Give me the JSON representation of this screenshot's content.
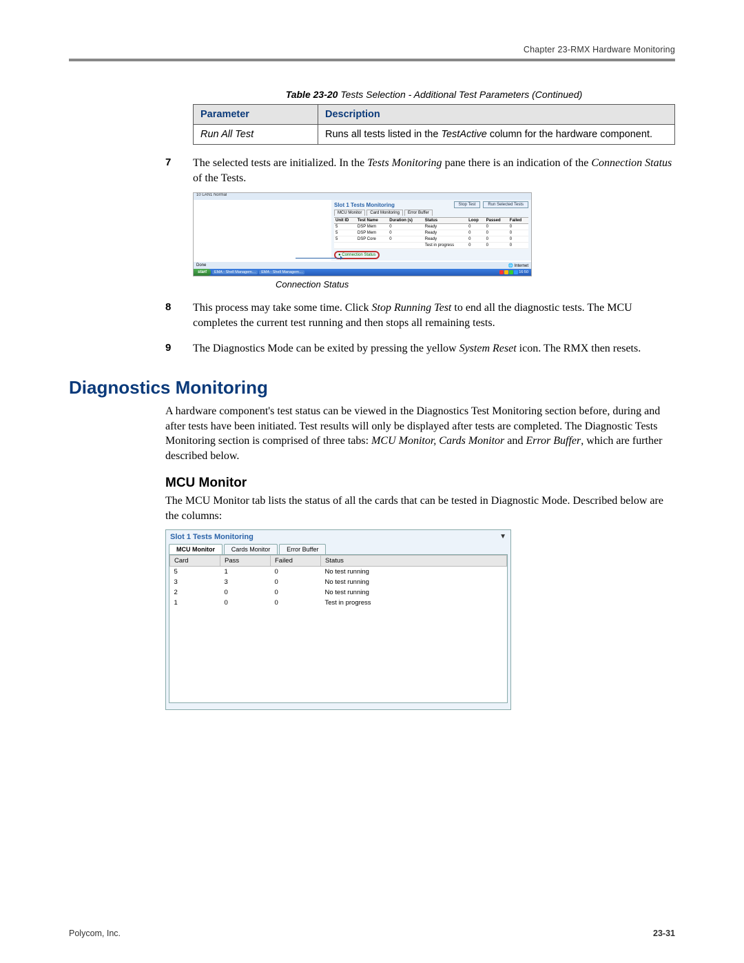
{
  "header": {
    "chapter": "Chapter 23-RMX Hardware Monitoring"
  },
  "table_caption": {
    "label": "Table 23-20",
    "rest": " Tests Selection - Additional Test Parameters (Continued)"
  },
  "param_table": {
    "headers": {
      "param": "Parameter",
      "desc": "Description"
    },
    "row": {
      "param": "Run All Test",
      "desc_1": "Runs all tests listed in the ",
      "desc_em": "TestActive",
      "desc_2": " column for the hardware component."
    }
  },
  "steps": {
    "s7": {
      "num": "7",
      "t1": "The selected tests are initialized. In the ",
      "em1": "Tests Monitoring",
      "t2": " pane there is an indication of the ",
      "em2": "Connection Status",
      "t3": " of the Tests."
    },
    "s8": {
      "num": "8",
      "t1": "This process may take some time. Click ",
      "em1": "Stop Running Test",
      "t2": " to end all the diagnostic tests. The MCU completes the current test running and then stops all remaining tests."
    },
    "s9": {
      "num": "9",
      "t1": "The Diagnostics Mode can be exited by pressing the yellow ",
      "em1": "System Reset",
      "t2": " icon. The RMX then resets."
    }
  },
  "shot1": {
    "topstrip": "10    LAN1    Normal",
    "btn_stop": "Stop Test",
    "btn_run": "Run Selected Tests",
    "pane_title": "Slot 1 Tests Monitoring",
    "tabs": {
      "a": "MCU Monitor",
      "b": "Card Monitoring",
      "c": "Error Buffer"
    },
    "cols": {
      "unit": "Unit ID",
      "name": "Test Name",
      "dur": "Duration (s)",
      "stat": "Status",
      "loop": "Loop",
      "pass": "Passed",
      "fail": "Failed"
    },
    "rows": [
      {
        "unit": "5",
        "name": "DSP Mem",
        "dur": "0",
        "stat": "Ready",
        "loop": "0",
        "pass": "0",
        "fail": "0"
      },
      {
        "unit": "5",
        "name": "DSP Mem",
        "dur": "0",
        "stat": "Ready",
        "loop": "0",
        "pass": "0",
        "fail": "0"
      },
      {
        "unit": "5",
        "name": "DSP Core",
        "dur": "0",
        "stat": "Ready",
        "loop": "0",
        "pass": "0",
        "fail": "0"
      },
      {
        "unit": "",
        "name": "",
        "dur": "",
        "stat": "Test in progress",
        "loop": "0",
        "pass": "0",
        "fail": "0"
      }
    ],
    "conn": "Connection Status",
    "status_left": "Done",
    "status_right": "Internet",
    "start": "start",
    "task1": "EMA - Shell Managem…",
    "task2": "EMA - Shell Managem…",
    "clock": "16:50"
  },
  "caption_conn": "Connection Status",
  "section_title": "Diagnostics Monitoring",
  "section_body": {
    "p1a": "A hardware component's test status can be viewed in the Diagnostics Test Monitoring section before, during and after tests have been initiated. Test results will only be displayed after tests are completed. The Diagnostic Tests Monitoring section is comprised of three tabs: ",
    "em": "MCU Monitor, Cards Monitor",
    "p1b": " and ",
    "em2": "Error Buffer",
    "p1c": ", which are further described below."
  },
  "sub_title": "MCU Monitor",
  "sub_body": "The MCU Monitor tab lists the status of all the cards that can be tested in Diagnostic Mode. Described below are the columns:",
  "shot2": {
    "title": "Slot 1 Tests Monitoring",
    "tabs": {
      "a": "MCU Monitor",
      "b": "Cards Monitor",
      "c": "Error Buffer"
    },
    "cols": {
      "card": "Card",
      "pass": "Pass",
      "fail": "Failed",
      "stat": "Status"
    },
    "rows": [
      {
        "card": "5",
        "pass": "1",
        "fail": "0",
        "stat": "No test running"
      },
      {
        "card": "3",
        "pass": "3",
        "fail": "0",
        "stat": "No test running"
      },
      {
        "card": "2",
        "pass": "0",
        "fail": "0",
        "stat": "No test running"
      },
      {
        "card": "1",
        "pass": "0",
        "fail": "0",
        "stat": "Test in progress"
      }
    ]
  },
  "footer": {
    "left": "Polycom, Inc.",
    "right": "23-31"
  }
}
